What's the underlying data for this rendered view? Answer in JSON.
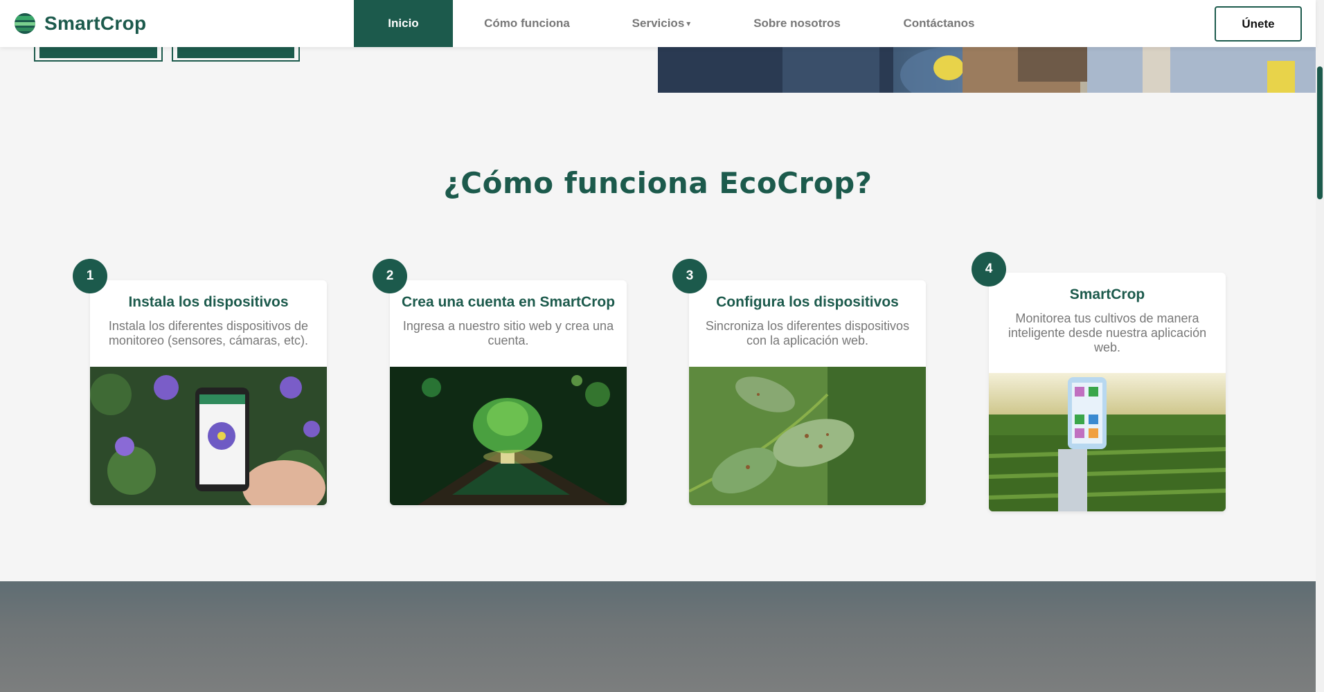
{
  "header": {
    "brand": "SmartCrop",
    "nav": [
      {
        "label": "Inicio",
        "active": true
      },
      {
        "label": "Cómo funciona",
        "active": false
      },
      {
        "label": "Servicios",
        "active": false,
        "caret": "▾"
      },
      {
        "label": "Sobre nosotros",
        "active": false
      },
      {
        "label": "Contáctanos",
        "active": false
      }
    ],
    "join_label": "Únete"
  },
  "section": {
    "title": "¿Cómo funciona EcoCrop?",
    "steps": [
      {
        "number": "1",
        "title": "Instala los dispositivos",
        "desc": "Instala los diferentes dispositivos de monitoreo (sensores, cámaras, etc).",
        "image": "phone-with-flowers"
      },
      {
        "number": "2",
        "title": "Crea una cuenta en SmartCrop",
        "desc": "Ingresa a nuestro sitio web y crea una cuenta.",
        "image": "tree-on-circuit-board"
      },
      {
        "number": "3",
        "title": "Configura los dispositivos",
        "desc": "Sincroniza los diferentes dispositivos con la aplicación web.",
        "image": "diseased-leaves"
      },
      {
        "number": "4",
        "title": "SmartCrop",
        "desc": "Monitorea tus cultivos de manera inteligente desde nuestra aplicación web.",
        "image": "robot-hand-phone-cornfield"
      }
    ]
  },
  "colors": {
    "brand_green": "#1c5a4c",
    "background": "#f5f5f5",
    "muted_text": "#777777"
  }
}
